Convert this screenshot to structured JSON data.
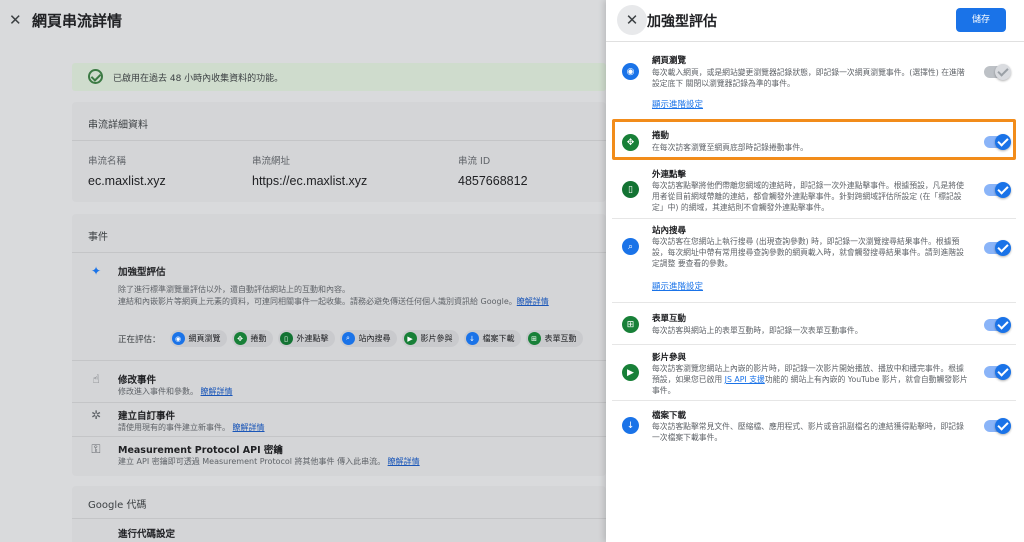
{
  "background": {
    "title": "網頁串流詳情",
    "notice": "已啟用在過去 48 小時內收集資料的功能。",
    "details_card": {
      "heading": "串流詳細資料",
      "fields": [
        {
          "label": "串流名稱",
          "value": "ec.maxlist.xyz"
        },
        {
          "label": "串流網址",
          "value": "https://ec.maxlist.xyz"
        },
        {
          "label": "串流 ID",
          "value": "4857668812"
        }
      ]
    },
    "events_card": {
      "heading": "事件",
      "enhanced": {
        "title": "加強型評估",
        "desc_line1": "除了進行標準瀏覽量評估以外，還自動評估網站上的互動和內容。",
        "desc_line2": "連結和內嵌影片等網頁上元素的資料，可連同相關事件一起收集。請務必避免傳送任何個人識別資訊給 Google。",
        "learn_more": "瞭解詳情"
      },
      "measuring_label": "正在評估：",
      "chips": [
        {
          "label": "網頁瀏覽",
          "color": "#1a73e8"
        },
        {
          "label": "捲動",
          "color": "#188038"
        },
        {
          "label": "外連點擊",
          "color": "#137333"
        },
        {
          "label": "站內搜尋",
          "color": "#1a73e8"
        },
        {
          "label": "影片參與",
          "color": "#188038"
        },
        {
          "label": "檔案下載",
          "color": "#1a73e8"
        },
        {
          "label": "表單互動",
          "color": "#188038"
        }
      ],
      "rows": [
        {
          "title": "修改事件",
          "desc": "修改進入事件和參數。",
          "link": "瞭解詳情"
        },
        {
          "title": "建立自訂事件",
          "desc": "請使用現有的事件建立新事件。",
          "link": "瞭解詳情"
        },
        {
          "title": "Measurement Protocol API 密鑰",
          "desc": "建立 API 密鑰即可透過 Measurement Protocol 將其他事件 傳入此串流。",
          "link": "瞭解詳情"
        }
      ]
    },
    "google_tag_card": {
      "heading": "Google 代碼",
      "row_title": "進行代碼設定"
    }
  },
  "panel": {
    "title": "加強型評估",
    "save_label": "儲存",
    "advanced_label": "顯示進階設定",
    "items": [
      {
        "name": "網頁瀏覽",
        "desc": "每次載入網頁，或是網站變更瀏覽器記錄狀態，即記錄一次網頁瀏覽事件。(選擇性) 在進階設定底下 關閉以瀏覽器記錄為準的事件。",
        "enabled": false,
        "color": "#1a73e8",
        "icon": "eye-icon"
      },
      {
        "name": "捲動",
        "desc": "在每次訪客瀏覽至網頁底部時記錄捲動事件。",
        "enabled": true,
        "color": "#188038",
        "icon": "scroll-icon"
      },
      {
        "name": "外連點擊",
        "desc": "每次訪客點擊將他們帶離您網域的連結時，即記錄一次外連點擊事件。根據預設，凡是將使用者從目前網域帶離的連結，都會觸發外連點擊事件。針對跨網域評估所設定 (在「標記設定」中) 的網域，其連結則不會觸發外連點擊事件。",
        "enabled": true,
        "color": "#137333",
        "icon": "mouse-icon"
      },
      {
        "name": "站內搜尋",
        "desc": "每次訪客在您網站上執行搜尋 (出現查詢參數) 時，即記錄一次瀏覽搜尋結果事件。根據預設，每次網址中帶有常用搜尋查詢參數的網頁載入時，就會觸發搜尋結果事件。請到進階設定調整 要查看的參數。",
        "enabled": true,
        "color": "#1a73e8",
        "icon": "search-icon"
      },
      {
        "name": "表單互動",
        "desc": "每次訪客與網站上的表單互動時，即記錄一次表單互動事件。",
        "enabled": true,
        "color": "#188038",
        "icon": "form-icon"
      },
      {
        "name": "影片參與",
        "desc_before": "每次訪客瀏覽您網站上內嵌的影片時，即記錄一次影片開始播放、播放中和播完事件。根據預設，如果您已啟用 ",
        "desc_link": "JS API 支援",
        "desc_after": "功能的 網站上有內嵌的 YouTube 影片，就會自動觸發影片事件。",
        "enabled": true,
        "color": "#188038",
        "icon": "play-icon"
      },
      {
        "name": "檔案下載",
        "desc": "每次訪客點擊常見文件、壓縮檔、應用程式、影片或音訊副檔名的連結獲得點擊時，即記錄一次檔案下載事件。",
        "enabled": true,
        "color": "#1a73e8",
        "icon": "download-icon"
      }
    ]
  }
}
